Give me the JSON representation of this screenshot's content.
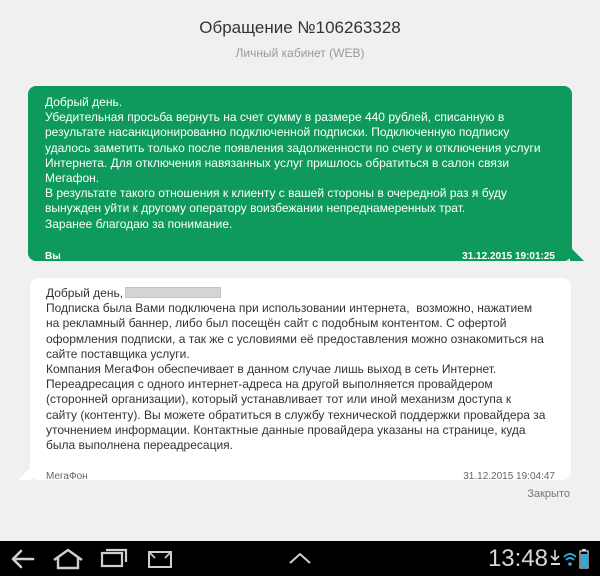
{
  "header": {
    "title": "Обращение №106263328",
    "subtitle": "Личный кабинет (WEB)"
  },
  "messages": [
    {
      "direction": "outgoing",
      "lines": [
        "Добрый день.",
        "Убедительная просьба вернуть на счет сумму в размере 440 рублей, списанную в",
        "результате насанкционированно подключенной подписки. Подключенную подписку",
        "удалось заметить только после появления задолженности по счету и отключения услуги",
        "Интернета. Для отключения навязанных услуг пришлось обратиться в салон связи",
        "Мегафон.",
        "В результате такого отношения к клиенту с вашей стороны в очередной раз я буду",
        "вынужден уйти к другому оператору воизбежании непреднамеренных трат.",
        "Заранее благодаю за понимание."
      ],
      "sender": "Вы",
      "timestamp": "31.12.2015 19:01:25"
    },
    {
      "direction": "incoming",
      "greeting": "Добрый день,",
      "lines": [
        "Подписка была Вами подключена при использовании интернета,  возможно, нажатием",
        "на рекламный баннер, либо был посещён сайт с подобным контентом. С офертой",
        "оформления подписки, а так же с условиями её предоставления можно ознакомиться на",
        "сайте поставщика услуги.",
        "Компания МегаФон обеспечивает в данном случае лишь выход в сеть Интернет.",
        "Переадресация с одного интернет-адреса на другой выполняется провайдером",
        "(сторонней организации), который устанавливает тот или иной механизм доступа к",
        "сайту (контенту). Вы можете обратиться в службу технической поддержки провайдера за",
        "уточнением информации. Контактные данные провайдера указаны на странице, куда",
        "была выполнена переадресация."
      ],
      "sender": "МегаФон",
      "timestamp": "31.12.2015 19:04:47"
    }
  ],
  "close_label": "Закрыто",
  "system_bar": {
    "time": "13:48",
    "icons": [
      "back-icon",
      "home-icon",
      "recent-apps-icon",
      "menu-up-icon",
      "download-icon",
      "wifi-icon",
      "battery-icon"
    ]
  },
  "colors": {
    "outgoing_bubble": "#0f9a5d",
    "incoming_bubble": "#ffffff",
    "background": "#f0f0f0",
    "navbar": "#000000"
  }
}
